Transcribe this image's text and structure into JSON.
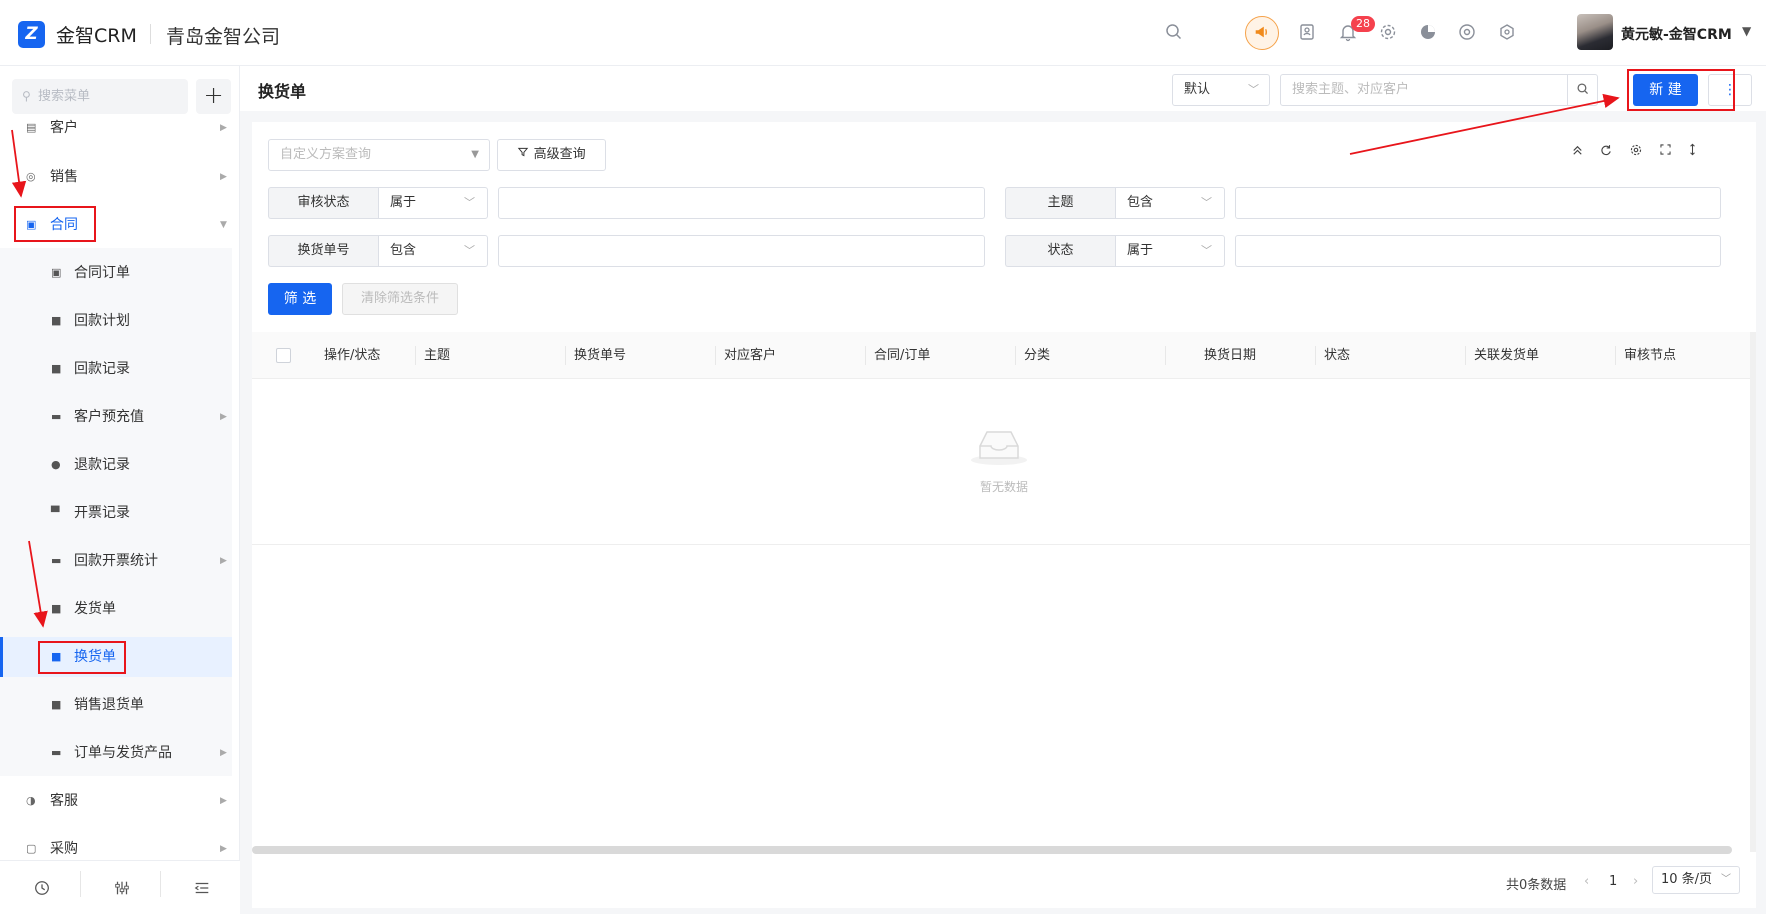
{
  "header": {
    "app_name": "金智CRM",
    "company": "青岛金智公司",
    "notification_count": "28",
    "user_name": "黄元敏-金智CRM"
  },
  "sidebar": {
    "search_placeholder": "搜索菜单",
    "items": [
      {
        "label": "客户",
        "icon": "building-icon"
      },
      {
        "label": "销售",
        "icon": "target-icon"
      },
      {
        "label": "合同",
        "icon": "contract-icon",
        "expanded": true
      },
      {
        "label": "客服",
        "icon": "headset-icon"
      },
      {
        "label": "采购",
        "icon": "cart-icon"
      }
    ],
    "sub_items": [
      {
        "label": "合同订单",
        "icon": "contract-order-icon"
      },
      {
        "label": "回款计划",
        "icon": "briefcase-icon"
      },
      {
        "label": "回款记录",
        "icon": "briefcase-icon"
      },
      {
        "label": "客户预充值",
        "icon": "folder-icon"
      },
      {
        "label": "退款记录",
        "icon": "refund-icon"
      },
      {
        "label": "开票记录",
        "icon": "invoice-icon"
      },
      {
        "label": "回款开票统计",
        "icon": "folder-icon"
      },
      {
        "label": "发货单",
        "icon": "box-icon"
      },
      {
        "label": "换货单",
        "icon": "box-icon",
        "active": true
      },
      {
        "label": "销售退货单",
        "icon": "box-icon"
      },
      {
        "label": "订单与发货产品",
        "icon": "folder-icon"
      }
    ]
  },
  "page": {
    "title": "换货单",
    "view_select": "默认",
    "search_placeholder": "搜索主题、对应客户",
    "new_button": "新 建",
    "more_button": "⋮"
  },
  "filters": {
    "scheme_placeholder": "自定义方案查询",
    "advanced_button": "高级查询",
    "rows": [
      {
        "label": "审核状态",
        "op": "属于"
      },
      {
        "label": "主题",
        "op": "包含"
      },
      {
        "label": "换货单号",
        "op": "包含"
      },
      {
        "label": "状态",
        "op": "属于"
      }
    ],
    "filter_button": "筛 选",
    "clear_button": "清除筛选条件"
  },
  "table": {
    "columns": [
      "操作/状态",
      "主题",
      "换货单号",
      "对应客户",
      "合同/订单",
      "分类",
      "换货日期",
      "状态",
      "关联发货单",
      "审核节点"
    ],
    "empty_text": "暂无数据"
  },
  "pagination": {
    "total": "共0条数据",
    "page": "1",
    "page_size": "10 条/页"
  },
  "colors": {
    "primary": "#1665f0",
    "annotation": "#e8151b",
    "badge": "#f5414d"
  }
}
